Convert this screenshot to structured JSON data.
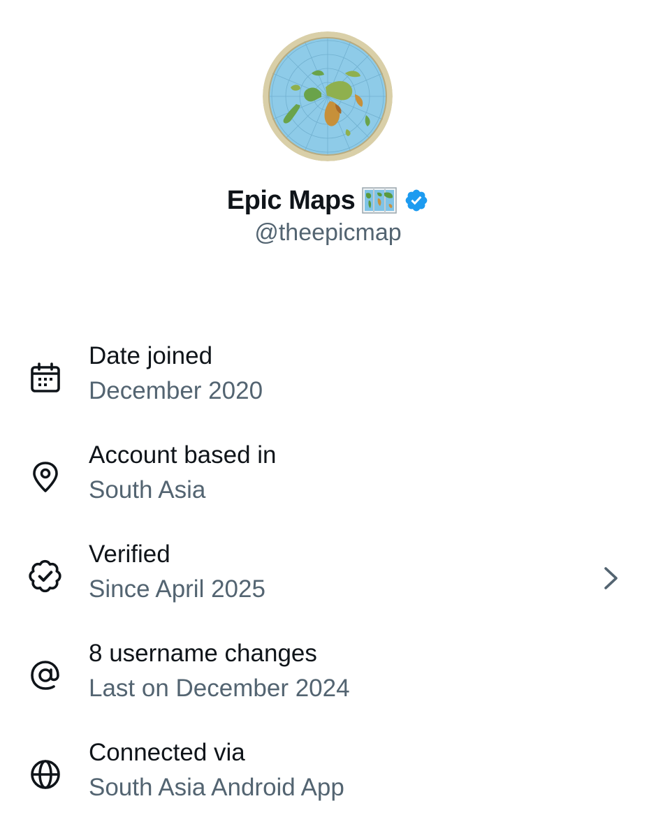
{
  "profile": {
    "display_name": "Epic Maps",
    "handle": "@theepicmap",
    "avatar_icon": "flat-earth-map-avatar",
    "name_emoji_icon": "world-map-emoji-icon",
    "verified_icon": "verified-badge-icon",
    "verified_color": "#1d9bf0"
  },
  "info_items": [
    {
      "icon": "calendar-icon",
      "title": "Date joined",
      "subtitle": "December 2020",
      "has_chevron": false
    },
    {
      "icon": "location-pin-icon",
      "title": "Account based in",
      "subtitle": "South Asia",
      "has_chevron": false
    },
    {
      "icon": "verified-outline-icon",
      "title": "Verified",
      "subtitle": "Since April 2025",
      "has_chevron": true
    },
    {
      "icon": "at-sign-icon",
      "title": "8 username changes",
      "subtitle": "Last on December 2024",
      "has_chevron": false
    },
    {
      "icon": "globe-icon",
      "title": "Connected via",
      "subtitle": "South Asia Android App",
      "has_chevron": false
    }
  ],
  "colors": {
    "primary_text": "#0f1419",
    "secondary_text": "#536471"
  }
}
